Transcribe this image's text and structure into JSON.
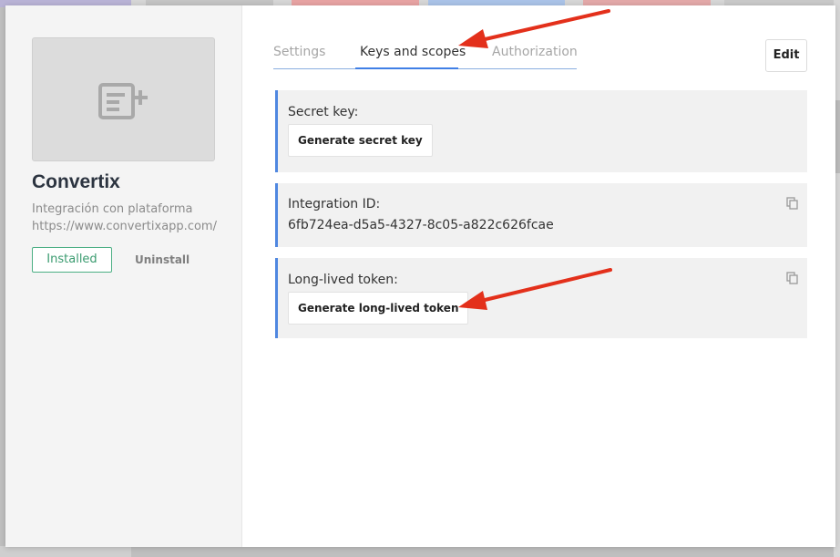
{
  "app": {
    "name": "Convertix",
    "description": "Integración con plataforma",
    "url": "https://www.convertixapp.com/",
    "status_badge": "Installed",
    "uninstall_label": "Uninstall"
  },
  "tabs": [
    {
      "label": "Settings",
      "active": false
    },
    {
      "label": "Keys and scopes",
      "active": true
    },
    {
      "label": "Authorization",
      "active": false
    }
  ],
  "edit_label": "Edit",
  "panels": {
    "secret_key": {
      "label": "Secret key:",
      "button": "Generate secret key"
    },
    "integration_id": {
      "label": "Integration ID:",
      "value": "6fb724ea-d5a5-4327-8c05-a822c626fcae",
      "copy_icon": "copy-icon"
    },
    "long_lived_token": {
      "label": "Long-lived token:",
      "button": "Generate long-lived token",
      "copy_icon": "copy-icon"
    }
  },
  "colors": {
    "accent": "#3f7fe6",
    "installed": "#4caf84",
    "annotation_arrow": "#e3301b"
  }
}
